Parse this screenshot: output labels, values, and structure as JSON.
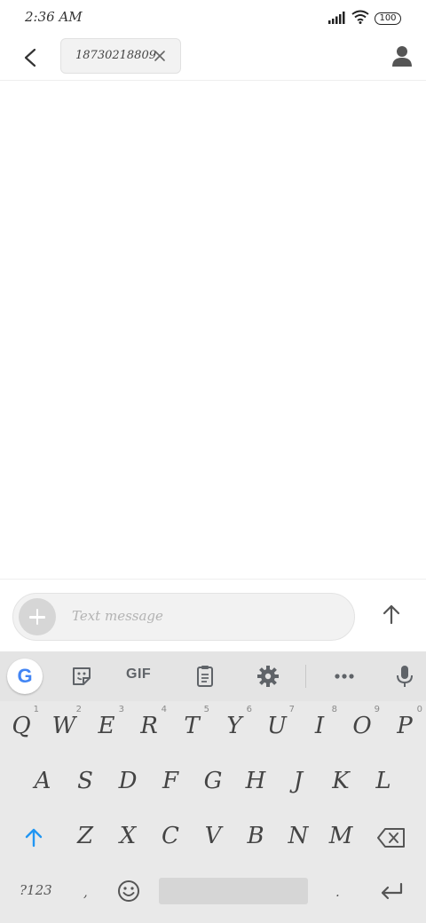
{
  "status": {
    "time": "2:36 AM",
    "battery": "100"
  },
  "header": {
    "recipient": "18730218809"
  },
  "composer": {
    "placeholder": "Text message"
  },
  "toolbar": {
    "google_letter": "G",
    "gif_label": "GIF"
  },
  "keyboard": {
    "row1": [
      {
        "label": "Q",
        "hint": "1"
      },
      {
        "label": "W",
        "hint": "2"
      },
      {
        "label": "E",
        "hint": "3"
      },
      {
        "label": "R",
        "hint": "4"
      },
      {
        "label": "T",
        "hint": "5"
      },
      {
        "label": "Y",
        "hint": "6"
      },
      {
        "label": "U",
        "hint": "7"
      },
      {
        "label": "I",
        "hint": "8"
      },
      {
        "label": "O",
        "hint": "9"
      },
      {
        "label": "P",
        "hint": "0"
      }
    ],
    "row2": [
      "A",
      "S",
      "D",
      "F",
      "G",
      "H",
      "J",
      "K",
      "L"
    ],
    "row3": [
      "Z",
      "X",
      "C",
      "V",
      "B",
      "N",
      "M"
    ],
    "symbols": "?123",
    "comma": ",",
    "period": "."
  },
  "colors": {
    "accent": "#2196F3",
    "keyboard_bg": "#e9e9e9",
    "toolbar_bg": "#e4e4e4"
  },
  "icons": [
    "back-arrow-icon",
    "close-icon",
    "person-icon",
    "plus-icon",
    "send-arrow-icon",
    "google-icon",
    "sticker-icon",
    "clipboard-icon",
    "gear-icon",
    "more-icon",
    "mic-icon",
    "shift-icon",
    "backspace-icon",
    "emoji-icon",
    "enter-icon",
    "signal-icon",
    "wifi-icon"
  ]
}
